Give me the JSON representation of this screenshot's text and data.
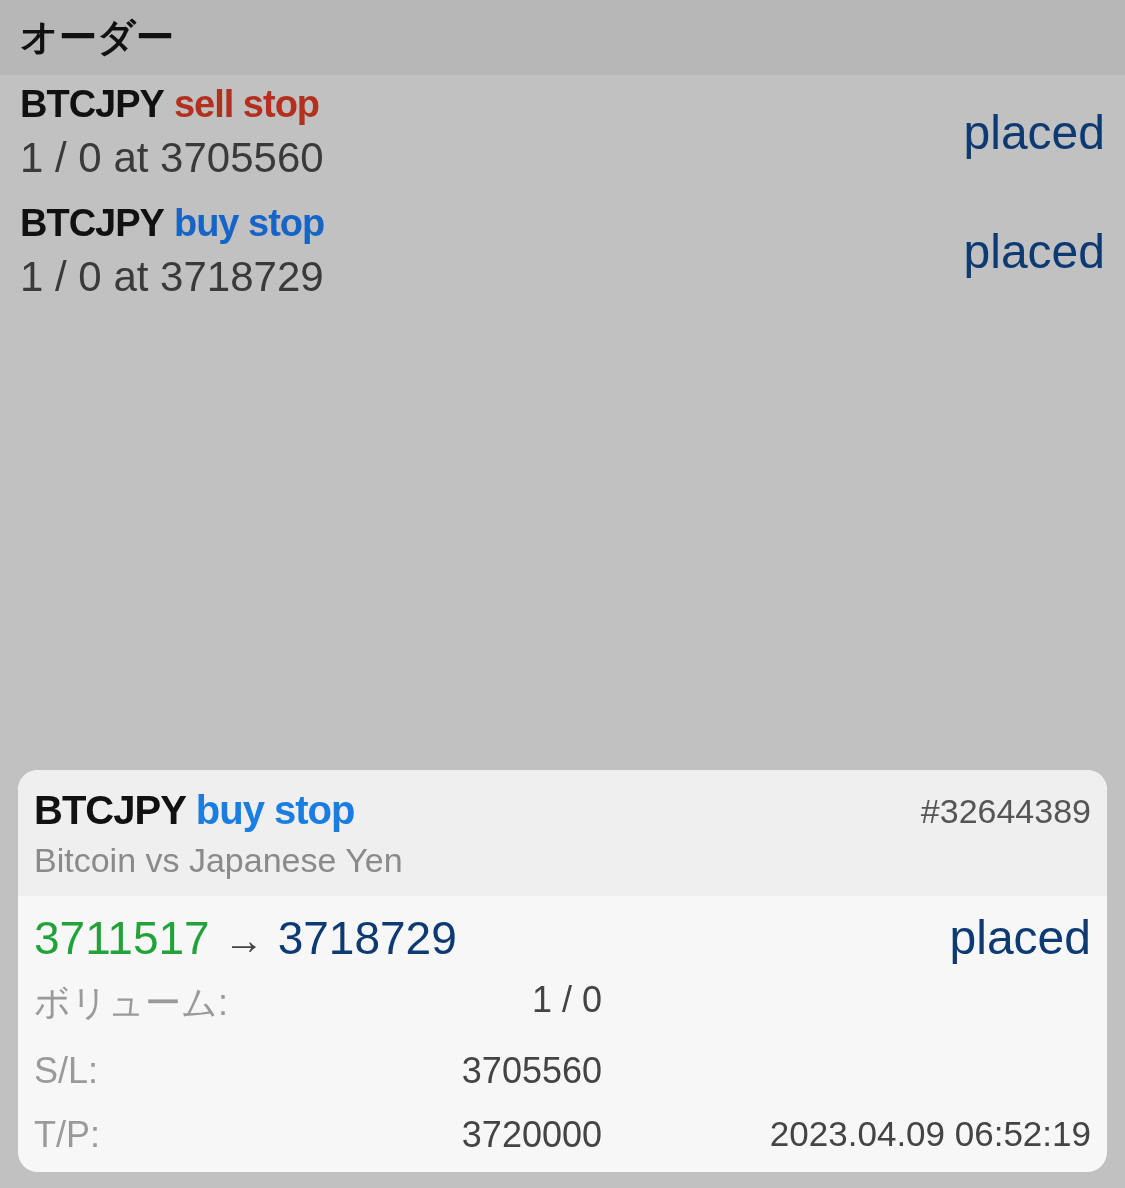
{
  "header": {
    "title": "オーダー"
  },
  "orders": [
    {
      "symbol": "BTCJPY",
      "type": "sell stop",
      "kind": "sell",
      "detail": "1 / 0 at 3705560",
      "status": "placed"
    },
    {
      "symbol": "BTCJPY",
      "type": "buy stop",
      "kind": "buy",
      "detail": "1 / 0 at 3718729",
      "status": "placed"
    }
  ],
  "detail_card": {
    "symbol": "BTCJPY",
    "type": "buy stop",
    "kind": "buy",
    "order_number": "#32644389",
    "description": "Bitcoin vs Japanese Yen",
    "open_price": "3711517",
    "arrow": "→",
    "target_price": "3718729",
    "status": "placed",
    "fields": [
      {
        "label": "ボリューム:",
        "value": "1 / 0"
      },
      {
        "label": "S/L:",
        "value": "3705560"
      },
      {
        "label": "T/P:",
        "value": "3720000"
      }
    ],
    "timestamp": "2023.04.09 06:52:19"
  }
}
